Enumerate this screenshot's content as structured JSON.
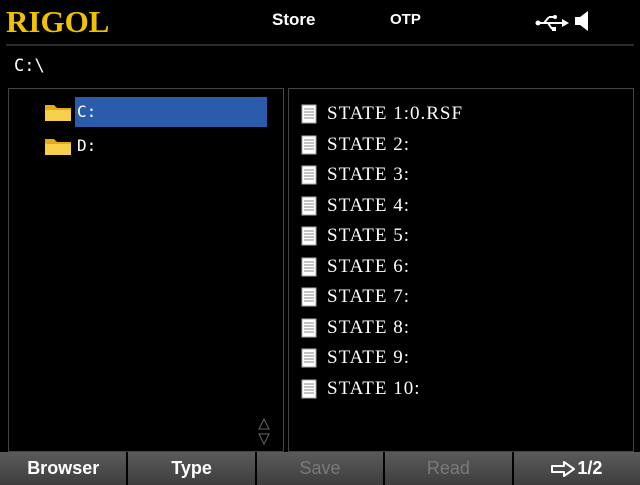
{
  "header": {
    "logo": "RIGOL",
    "mode": "Store",
    "param": "OTP",
    "icons": [
      "usb-icon",
      "speaker-icon"
    ]
  },
  "path": "C:\\",
  "directories": [
    {
      "label": "C:",
      "selected": true,
      "icon": "folder-icon"
    },
    {
      "label": "D:",
      "selected": false,
      "icon": "folder-icon"
    }
  ],
  "files": [
    {
      "label": "STATE 1:0.RSF",
      "icon": "document-icon"
    },
    {
      "label": "STATE 2:",
      "icon": "document-icon"
    },
    {
      "label": "STATE 3:",
      "icon": "document-icon"
    },
    {
      "label": "STATE 4:",
      "icon": "document-icon"
    },
    {
      "label": "STATE 5:",
      "icon": "document-icon"
    },
    {
      "label": "STATE 6:",
      "icon": "document-icon"
    },
    {
      "label": "STATE 7:",
      "icon": "document-icon"
    },
    {
      "label": "STATE 8:",
      "icon": "document-icon"
    },
    {
      "label": "STATE 9:",
      "icon": "document-icon"
    },
    {
      "label": "STATE 10:",
      "icon": "document-icon"
    }
  ],
  "softkeys": [
    {
      "label": "Browser",
      "enabled": true
    },
    {
      "label": "Type",
      "enabled": true
    },
    {
      "label": "Save",
      "enabled": false
    },
    {
      "label": "Read",
      "enabled": false
    },
    {
      "label": "1/2",
      "enabled": true,
      "icon": "arrow-right-icon"
    }
  ],
  "colors": {
    "logo": "#f2c200",
    "selection": "#2b5cab",
    "softkey_bg": "#4a4a4a",
    "disabled_text": "#7a7a7a"
  }
}
